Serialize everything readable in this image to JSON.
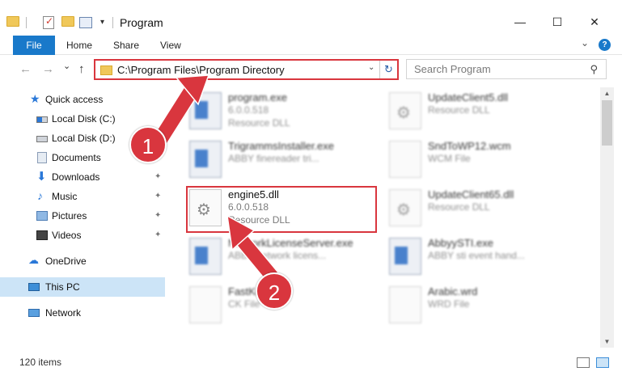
{
  "window": {
    "title": "Program",
    "minimize": "—",
    "maximize": "☐",
    "close": "✕"
  },
  "ribbon": {
    "tabs": [
      "File",
      "Home",
      "Share",
      "View"
    ],
    "collapse_glyph": "⌄",
    "help_glyph": "?"
  },
  "nav": {
    "back": "←",
    "forward": "→",
    "recent": "⌄",
    "up": "↑",
    "address": "C:\\Program Files\\Program Directory",
    "address_dropdown": "⌄",
    "refresh": "↻",
    "search_placeholder": "Search Program",
    "search_glyph": "⚲"
  },
  "sidebar": {
    "items": [
      {
        "label": "Quick access",
        "icon": "star-icon"
      },
      {
        "label": "Local Disk (C:)",
        "icon": "disk-icon"
      },
      {
        "label": "Local Disk (D:)",
        "icon": "disk-icon"
      },
      {
        "label": "Documents",
        "icon": "documents-icon"
      },
      {
        "label": "Downloads",
        "icon": "download-icon"
      },
      {
        "label": "Music",
        "icon": "music-icon"
      },
      {
        "label": "Pictures",
        "icon": "pictures-icon"
      },
      {
        "label": "Videos",
        "icon": "videos-icon"
      },
      {
        "label": "OneDrive",
        "icon": "cloud-icon"
      },
      {
        "label": "This PC",
        "icon": "computer-icon"
      },
      {
        "label": "Network",
        "icon": "network-icon"
      }
    ],
    "pin_glyph": "📌"
  },
  "files": {
    "left": [
      {
        "name": "program.exe",
        "line1": "6.0.0.518",
        "line2": "Resource DLL"
      },
      {
        "name": "TrigrammsInstaller.exe",
        "line1": "ABBY finereader tri...",
        "line2": ""
      },
      {
        "name": "engine5.dll",
        "line1": "6.0.0.518",
        "line2": "Resource DLL"
      },
      {
        "name": "NetworkLicenseServer.exe",
        "line1": "ABBY network licens...",
        "line2": ""
      },
      {
        "name": "FastKe...",
        "line1": "CK File",
        "line2": ""
      }
    ],
    "right": [
      {
        "name": "UpdateClient5.dll",
        "line1": "Resource DLL",
        "line2": ""
      },
      {
        "name": "SndToWP12.wcm",
        "line1": "WCM File",
        "line2": ""
      },
      {
        "name": "UpdateClient65.dll",
        "line1": "Resource DLL",
        "line2": ""
      },
      {
        "name": "AbbyySTI.exe",
        "line1": "ABBY sti event hand...",
        "line2": ""
      },
      {
        "name": "Arabic.wrd",
        "line1": "WRD File",
        "line2": ""
      }
    ]
  },
  "status": {
    "item_count": "120 items"
  },
  "callouts": {
    "one": "1",
    "two": "2"
  },
  "colors": {
    "accent": "#1979ca",
    "highlight": "#d9363e",
    "selected": "#cce4f7"
  }
}
